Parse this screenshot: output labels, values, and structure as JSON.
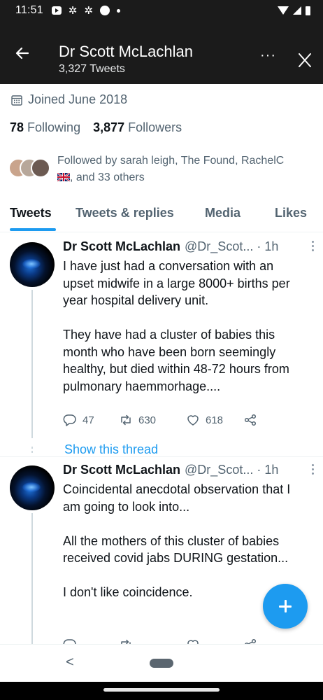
{
  "status_bar": {
    "time": "11:51"
  },
  "header": {
    "title": "Dr Scott McLachlan",
    "subtitle": "3,327 Tweets"
  },
  "profile": {
    "joined": "Joined June 2018",
    "following_count": "78",
    "following_label": "Following",
    "followers_count": "3,877",
    "followers_label": "Followers",
    "followed_by_line1": "Followed by sarah leigh, The Found, RachelC",
    "followed_by_line2": ", and 33 others"
  },
  "tabs": [
    {
      "label": "Tweets",
      "active": true
    },
    {
      "label": "Tweets & replies",
      "active": false
    },
    {
      "label": "Media",
      "active": false
    },
    {
      "label": "Likes",
      "active": false
    }
  ],
  "tweets": [
    {
      "name": "Dr Scott McLachlan",
      "meta": "@Dr_Scot... · 1h",
      "paragraphs": [
        "I have just had a conversation with an upset midwife in a large 8000+ births per year hospital delivery unit.",
        "They have had a cluster of babies this month who have been born seemingly healthy, but died within 48-72 hours from pulmonary haemmorhage...."
      ],
      "replies": "47",
      "retweets": "630",
      "likes": "618"
    },
    {
      "name": "Dr Scott McLachlan",
      "meta": "@Dr_Scot... · 1h",
      "paragraphs": [
        "Coincidental anecdotal observation that I am going to look into...",
        "All the mothers of this cluster of babies received covid jabs DURING gestation...",
        "I don't like coincidence."
      ]
    }
  ],
  "show_thread": "Show this thread",
  "nav": {
    "back_glyph": "<"
  },
  "colors": {
    "accent": "#1d9bf0",
    "header_bg": "#1b1b1b",
    "secondary_text": "#536471"
  }
}
